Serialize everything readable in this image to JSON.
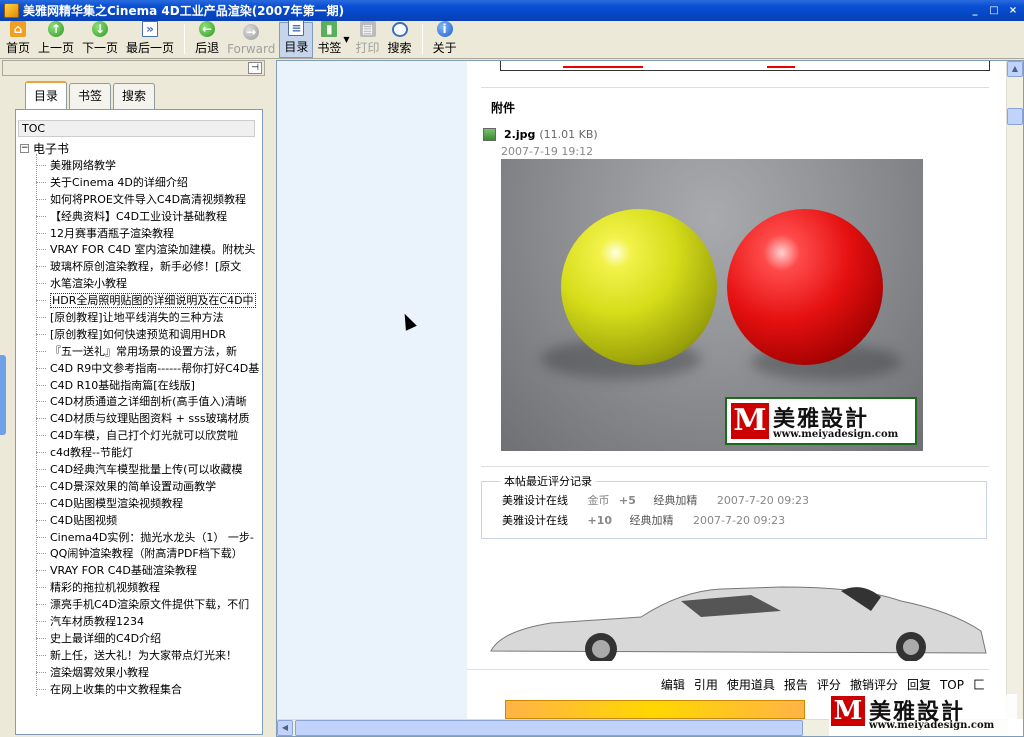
{
  "window": {
    "title": "美雅网精华集之Cinema 4D工业产品渲染(2007年第一期)",
    "controls": [
      "_",
      "□",
      "×"
    ]
  },
  "toolbar": {
    "buttons": [
      {
        "label": "首页",
        "icon": "home-icon",
        "enabled": true
      },
      {
        "label": "上一页",
        "icon": "arrow-up-icon",
        "enabled": true
      },
      {
        "label": "下一页",
        "icon": "arrow-down-icon",
        "enabled": true
      },
      {
        "label": "最后一页",
        "icon": "last-page-icon",
        "enabled": true
      },
      {
        "label": "后退",
        "icon": "back-icon",
        "enabled": true
      },
      {
        "label": "Forward",
        "icon": "forward-icon",
        "enabled": false
      },
      {
        "label": "目录",
        "icon": "toc-icon",
        "enabled": true,
        "active": true
      },
      {
        "label": "书签",
        "icon": "bookmark-icon",
        "enabled": true
      },
      {
        "label": "打印",
        "icon": "print-icon",
        "enabled": false
      },
      {
        "label": "搜索",
        "icon": "search-icon",
        "enabled": true
      },
      {
        "label": "关于",
        "icon": "info-icon",
        "enabled": true
      }
    ]
  },
  "sidebar": {
    "tabs": [
      "目录",
      "书签",
      "搜索"
    ],
    "active_tab": "目录",
    "toc_header": "TOC",
    "root": "电子书",
    "expander": "⊟",
    "items": [
      "美雅网络教学",
      "关于Cinema 4D的详细介绍",
      "如何将PROE文件导入C4D高清视频教程",
      "【经典资料】C4D工业设计基础教程",
      "12月赛事酒瓶子渲染教程",
      "VRAY FOR C4D 室内渲染加建模。附枕头",
      "玻璃杯原创渲染教程，新手必修！[原文",
      "水笔渲染小教程",
      "HDR全局照明贴图的详细说明及在C4D中",
      "[原创教程]让地平线消失的三种方法",
      "[原创教程]如何快速预览和调用HDR",
      "『五一送礼』常用场景的设置方法，新",
      "C4D R9中文参考指南------帮你打好C4D基",
      "C4D R10基础指南篇[在线版]",
      "C4D材质通道之详细剖析(高手值入)清晰",
      "C4D材质与纹理贴图资料 + sss玻璃材质",
      "C4D车模，自己打个灯光就可以欣赏啦",
      "c4d教程--节能灯",
      "C4D经典汽车模型批量上传(可以收藏模",
      "C4D景深效果的简单设置动画教学",
      "C4D贴图模型渲染视频教程",
      "C4D贴图视频",
      "Cinema4D实例：抛光水龙头（1） 一步-",
      "QQ闹钟渲染教程（附高清PDF档下载）",
      "VRAY FOR C4D基础渲染教程",
      "精彩的拖拉机视频教程",
      "漂亮手机C4D渲染原文件提供下载，不们",
      "汽车材质教程1234",
      "史上最详细的C4D介绍",
      "新上任，送大礼！为大家带点灯光来！",
      "渲染烟雾效果小教程",
      "在网上收集的中文教程集合"
    ],
    "selected_index": 8
  },
  "content": {
    "attachment_heading": "附件",
    "file": {
      "name": "2.jpg",
      "size": "(11.01 KB)",
      "date": "2007-7-19 19:12"
    },
    "image_logo": {
      "cn": "美雅設計",
      "url": "www.meiyadesign.com"
    },
    "rating_title": "本帖最近评分记录",
    "ratings": [
      {
        "user": "美雅设计在线",
        "type": "金币",
        "value": "+5",
        "reason": "经典加精",
        "date": "2007-7-20 09:23"
      },
      {
        "user": "美雅设计在线",
        "type": "",
        "value": "+10",
        "reason": "经典加精",
        "date": "2007-7-20 09:23"
      }
    ],
    "actions": [
      "编辑",
      "引用",
      "使用道具",
      "报告",
      "评分",
      "撤销评分",
      "回复",
      "TOP",
      "匚"
    ],
    "corner_logo": {
      "cn": "美雅設計",
      "url": "www.meiyadesign.com"
    }
  },
  "colors": {
    "titlebar": "#0a4fd3",
    "logo_red": "#cc0000",
    "yellow_ball": "#d6dd1a",
    "red_ball": "#e51010"
  }
}
